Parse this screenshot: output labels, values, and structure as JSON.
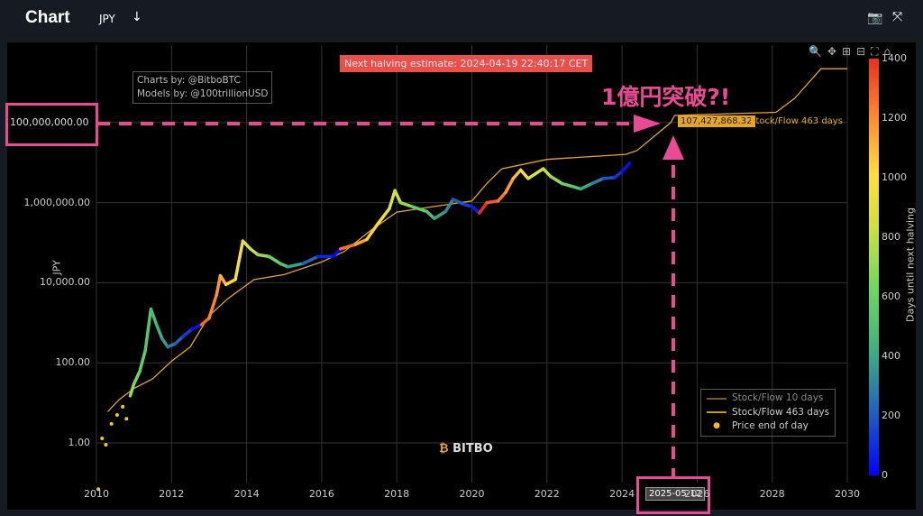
{
  "header": {
    "title": "Chart",
    "currency": "JPY",
    "download_icon": "arrow-down-icon",
    "camera_icon": "camera-icon",
    "expand_icon": "expand-icon"
  },
  "credits": {
    "line1": "Charts by: @BitboBTC",
    "line2": "Models by: @100trillionUSD"
  },
  "halving_banner": "Next halving estimate: 2024-04-19 22:40:17 CET",
  "annotation": {
    "headline": "1億円突破?!",
    "value_label": "100,000,000.00",
    "hover_value": "107,427,868.32",
    "hover_series": "Stock/Flow 463 days",
    "hover_date": "2025-05-12",
    "accent": "#e94a95"
  },
  "logo": "BITBO",
  "chart_data": {
    "type": "line",
    "ylabel": "JPY",
    "yscale": "log",
    "ylim": [
      0.3,
      5000000000
    ],
    "xlim": [
      2010,
      2030
    ],
    "yticks": [
      {
        "v": 1,
        "label": "1.00"
      },
      {
        "v": 100,
        "label": "100.00"
      },
      {
        "v": 10000,
        "label": "10,000.00"
      },
      {
        "v": 1000000,
        "label": "1,000,000.00"
      },
      {
        "v": 100000000,
        "label": "100,000,000.00"
      }
    ],
    "xticks": [
      "2010",
      "2012",
      "2014",
      "2016",
      "2018",
      "2020",
      "2022",
      "2024",
      "2026",
      "2028",
      "2030"
    ],
    "grid": true,
    "legend_position": "bottom-right",
    "legend": [
      "Stock/Flow 10 days",
      "Stock/Flow 463 days",
      "Price end of day"
    ],
    "colorbar": {
      "title": "Days until next halving",
      "ticks": [
        0,
        200,
        400,
        600,
        800,
        1000,
        1200,
        1400
      ],
      "range": [
        0,
        1400
      ]
    },
    "series": [
      {
        "name": "Price end of day",
        "type": "scatter-line",
        "points": [
          [
            2010.05,
            0.07
          ],
          [
            2010.15,
            1.3
          ],
          [
            2010.25,
            0.9
          ],
          [
            2010.4,
            3
          ],
          [
            2010.55,
            5
          ],
          [
            2010.7,
            8
          ],
          [
            2010.8,
            4
          ],
          [
            2010.9,
            15
          ],
          [
            2011.0,
            30
          ],
          [
            2011.15,
            60
          ],
          [
            2011.3,
            200
          ],
          [
            2011.45,
            2200
          ],
          [
            2011.6,
            900
          ],
          [
            2011.75,
            400
          ],
          [
            2011.9,
            250
          ],
          [
            2012.1,
            300
          ],
          [
            2012.3,
            450
          ],
          [
            2012.55,
            700
          ],
          [
            2012.8,
            900
          ],
          [
            2013.0,
            1300
          ],
          [
            2013.2,
            5000
          ],
          [
            2013.3,
            15000
          ],
          [
            2013.45,
            9000
          ],
          [
            2013.7,
            12000
          ],
          [
            2013.9,
            110000
          ],
          [
            2014.1,
            70000
          ],
          [
            2014.3,
            50000
          ],
          [
            2014.6,
            45000
          ],
          [
            2014.9,
            30000
          ],
          [
            2015.1,
            25000
          ],
          [
            2015.5,
            30000
          ],
          [
            2015.9,
            45000
          ],
          [
            2016.3,
            45000
          ],
          [
            2016.5,
            70000
          ],
          [
            2016.9,
            90000
          ],
          [
            2017.2,
            120000
          ],
          [
            2017.5,
            300000
          ],
          [
            2017.8,
            700000
          ],
          [
            2017.95,
            2000000
          ],
          [
            2018.1,
            1000000
          ],
          [
            2018.4,
            800000
          ],
          [
            2018.8,
            600000
          ],
          [
            2019.0,
            400000
          ],
          [
            2019.3,
            600000
          ],
          [
            2019.5,
            1200000
          ],
          [
            2019.8,
            900000
          ],
          [
            2020.0,
            800000
          ],
          [
            2020.2,
            550000
          ],
          [
            2020.4,
            1000000
          ],
          [
            2020.7,
            1100000
          ],
          [
            2020.9,
            1800000
          ],
          [
            2021.1,
            4000000
          ],
          [
            2021.3,
            6500000
          ],
          [
            2021.5,
            4000000
          ],
          [
            2021.9,
            7000000
          ],
          [
            2022.1,
            4500000
          ],
          [
            2022.4,
            3000000
          ],
          [
            2022.7,
            2500000
          ],
          [
            2022.9,
            2200000
          ],
          [
            2023.2,
            3000000
          ],
          [
            2023.5,
            4000000
          ],
          [
            2023.8,
            4200000
          ],
          [
            2024.0,
            6000000
          ],
          [
            2024.2,
            9500000
          ]
        ]
      },
      {
        "name": "Stock/Flow 463 days",
        "type": "line",
        "color": "#e6a52a",
        "points": [
          [
            2010.3,
            6
          ],
          [
            2010.6,
            12
          ],
          [
            2011.0,
            23
          ],
          [
            2011.5,
            40
          ],
          [
            2012.0,
            110
          ],
          [
            2012.5,
            250
          ],
          [
            2013.0,
            1500
          ],
          [
            2013.5,
            4000
          ],
          [
            2014.2,
            12000
          ],
          [
            2015.0,
            16000
          ],
          [
            2016.0,
            33000
          ],
          [
            2016.6,
            60000
          ],
          [
            2017.3,
            200000
          ],
          [
            2018.0,
            580000
          ],
          [
            2019.0,
            800000
          ],
          [
            2020.0,
            1100000
          ],
          [
            2020.4,
            3000000
          ],
          [
            2020.8,
            7000000
          ],
          [
            2022.0,
            12000000
          ],
          [
            2024.1,
            16000000
          ],
          [
            2024.4,
            20000000
          ],
          [
            2025.3,
            100000000
          ],
          [
            2025.4,
            150000000
          ],
          [
            2028.1,
            180000000
          ],
          [
            2028.6,
            400000000
          ],
          [
            2029.3,
            2200000000
          ],
          [
            2030.0,
            2200000000
          ]
        ]
      }
    ]
  }
}
